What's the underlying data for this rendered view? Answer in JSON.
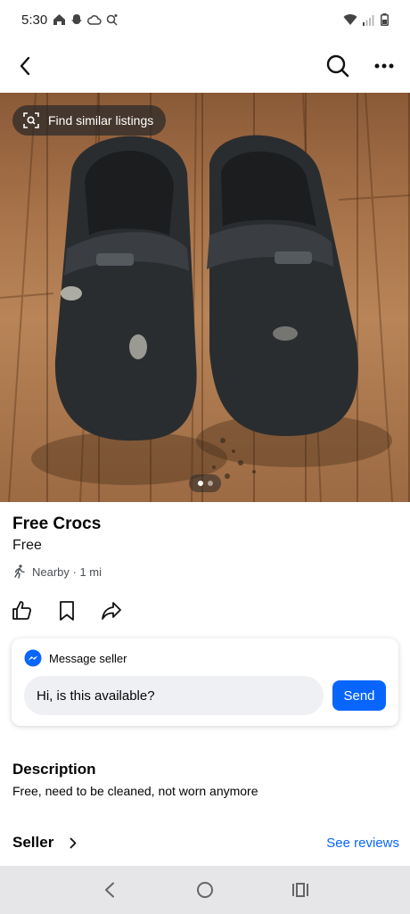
{
  "status_bar": {
    "time": "5:30"
  },
  "hero": {
    "find_similar_label": "Find similar listings",
    "image_count": 2,
    "active_image": 1
  },
  "listing": {
    "title": "Free Crocs",
    "price": "Free",
    "location": "Nearby · 1 mi"
  },
  "message": {
    "header": "Message seller",
    "input_value": "Hi, is this available?",
    "send_label": "Send"
  },
  "description": {
    "title": "Description",
    "text": "Free, need to be cleaned, not worn anymore"
  },
  "seller": {
    "title": "Seller",
    "reviews_link": "See reviews"
  },
  "colors": {
    "accent": "#0866ff",
    "text": "#050505",
    "secondary": "#4b4f56"
  }
}
